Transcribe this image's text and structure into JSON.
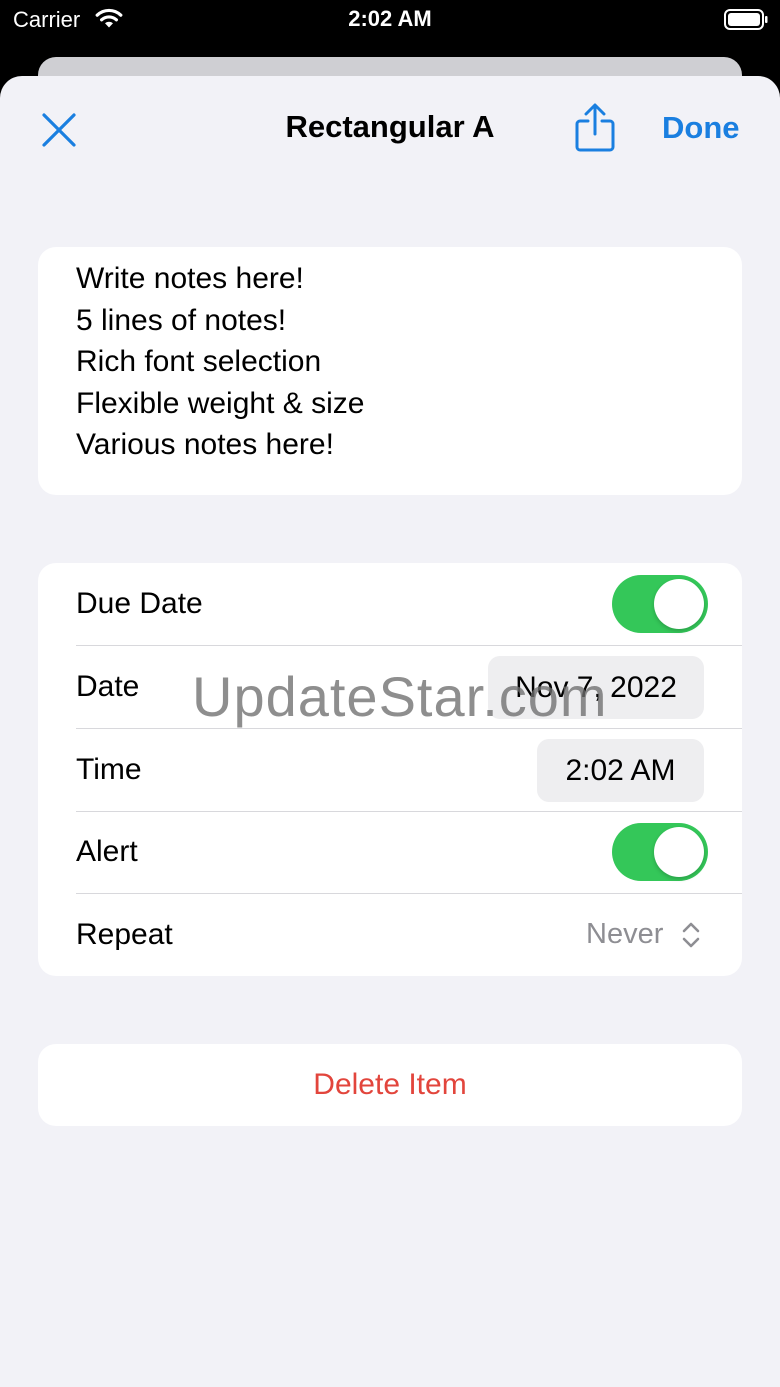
{
  "status_bar": {
    "carrier": "Carrier",
    "time": "2:02 AM"
  },
  "nav": {
    "title": "Rectangular A",
    "done_label": "Done",
    "accent_color": "#1a7fe0"
  },
  "notes": {
    "lines": [
      "Write notes here!",
      "5 lines of notes!",
      "Rich font selection",
      "Flexible weight & size",
      "Various notes here!"
    ]
  },
  "settings": {
    "due_date": {
      "label": "Due Date",
      "enabled": true
    },
    "date": {
      "label": "Date",
      "value": "Nov 7, 2022"
    },
    "time": {
      "label": "Time",
      "value": "2:02 AM"
    },
    "alert": {
      "label": "Alert",
      "enabled": true
    },
    "repeat": {
      "label": "Repeat",
      "value": "Never"
    },
    "toggle_on_color": "#34c759"
  },
  "delete": {
    "label": "Delete Item",
    "color": "#e2453c"
  },
  "watermark": "UpdateStar.com",
  "icons": {
    "close": "close-icon",
    "share": "share-icon",
    "wifi": "wifi-icon",
    "battery": "battery-icon",
    "chevron": "chevron-up-down-icon"
  }
}
